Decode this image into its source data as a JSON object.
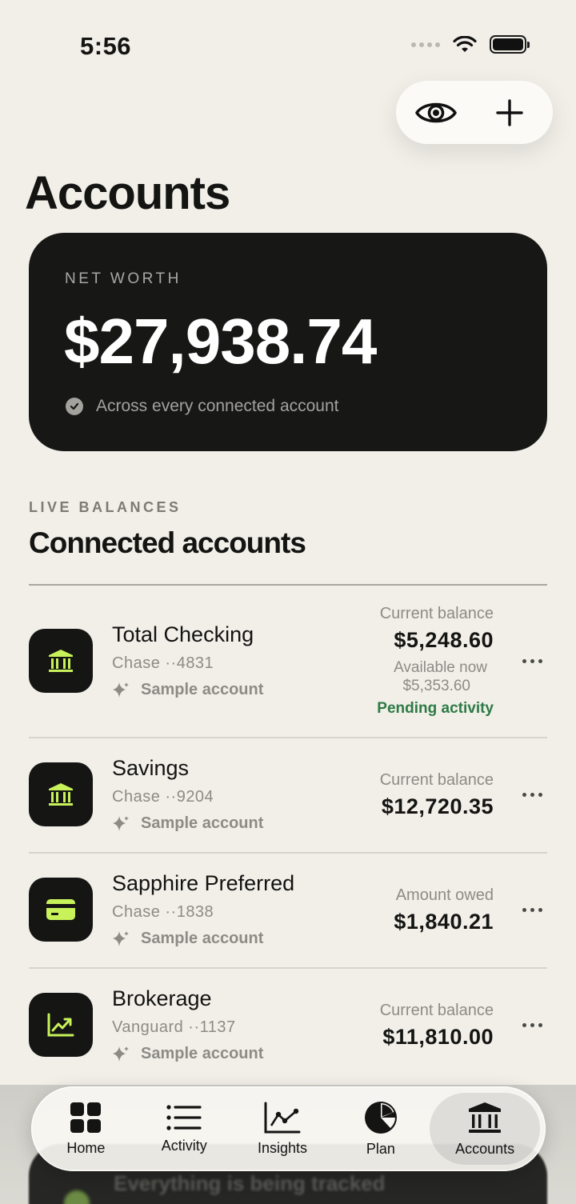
{
  "status_bar": {
    "time": "5:56"
  },
  "header": {
    "title": "Accounts"
  },
  "net_worth": {
    "label": "NET WORTH",
    "value": "$27,938.74",
    "subtitle": "Across every connected account"
  },
  "section": {
    "eyebrow": "LIVE BALANCES",
    "title": "Connected accounts"
  },
  "accounts": [
    {
      "name": "Total Checking",
      "institution": "Chase ··4831",
      "tag": "Sample account",
      "balance_label": "Current balance",
      "balance": "$5,248.60",
      "available_label": "Available now",
      "available": "$5,353.60",
      "status": "Pending activity",
      "icon": "bank-icon"
    },
    {
      "name": "Savings",
      "institution": "Chase ··9204",
      "tag": "Sample account",
      "balance_label": "Current balance",
      "balance": "$12,720.35",
      "icon": "bank-icon"
    },
    {
      "name": "Sapphire Preferred",
      "institution": "Chase ··1838",
      "tag": "Sample account",
      "balance_label": "Amount owed",
      "balance": "$1,840.21",
      "icon": "credit-card-icon"
    },
    {
      "name": "Brokerage",
      "institution": "Vanguard ··1137",
      "tag": "Sample account",
      "balance_label": "Current balance",
      "balance": "$11,810.00",
      "icon": "chart-up-icon"
    }
  ],
  "background_card": {
    "text": "Everything is being tracked"
  },
  "tabbar": {
    "tabs": [
      {
        "label": "Home",
        "icon": "grid-icon"
      },
      {
        "label": "Activity",
        "icon": "list-icon"
      },
      {
        "label": "Insights",
        "icon": "line-chart-icon"
      },
      {
        "label": "Plan",
        "icon": "pie-chart-icon"
      },
      {
        "label": "Accounts",
        "icon": "bank-icon"
      }
    ],
    "active": "Accounts"
  },
  "colors": {
    "background": "#f1efe8",
    "card_dark": "#171716",
    "accent_lime": "#c8f25a",
    "pending_green": "#2c7a45"
  }
}
